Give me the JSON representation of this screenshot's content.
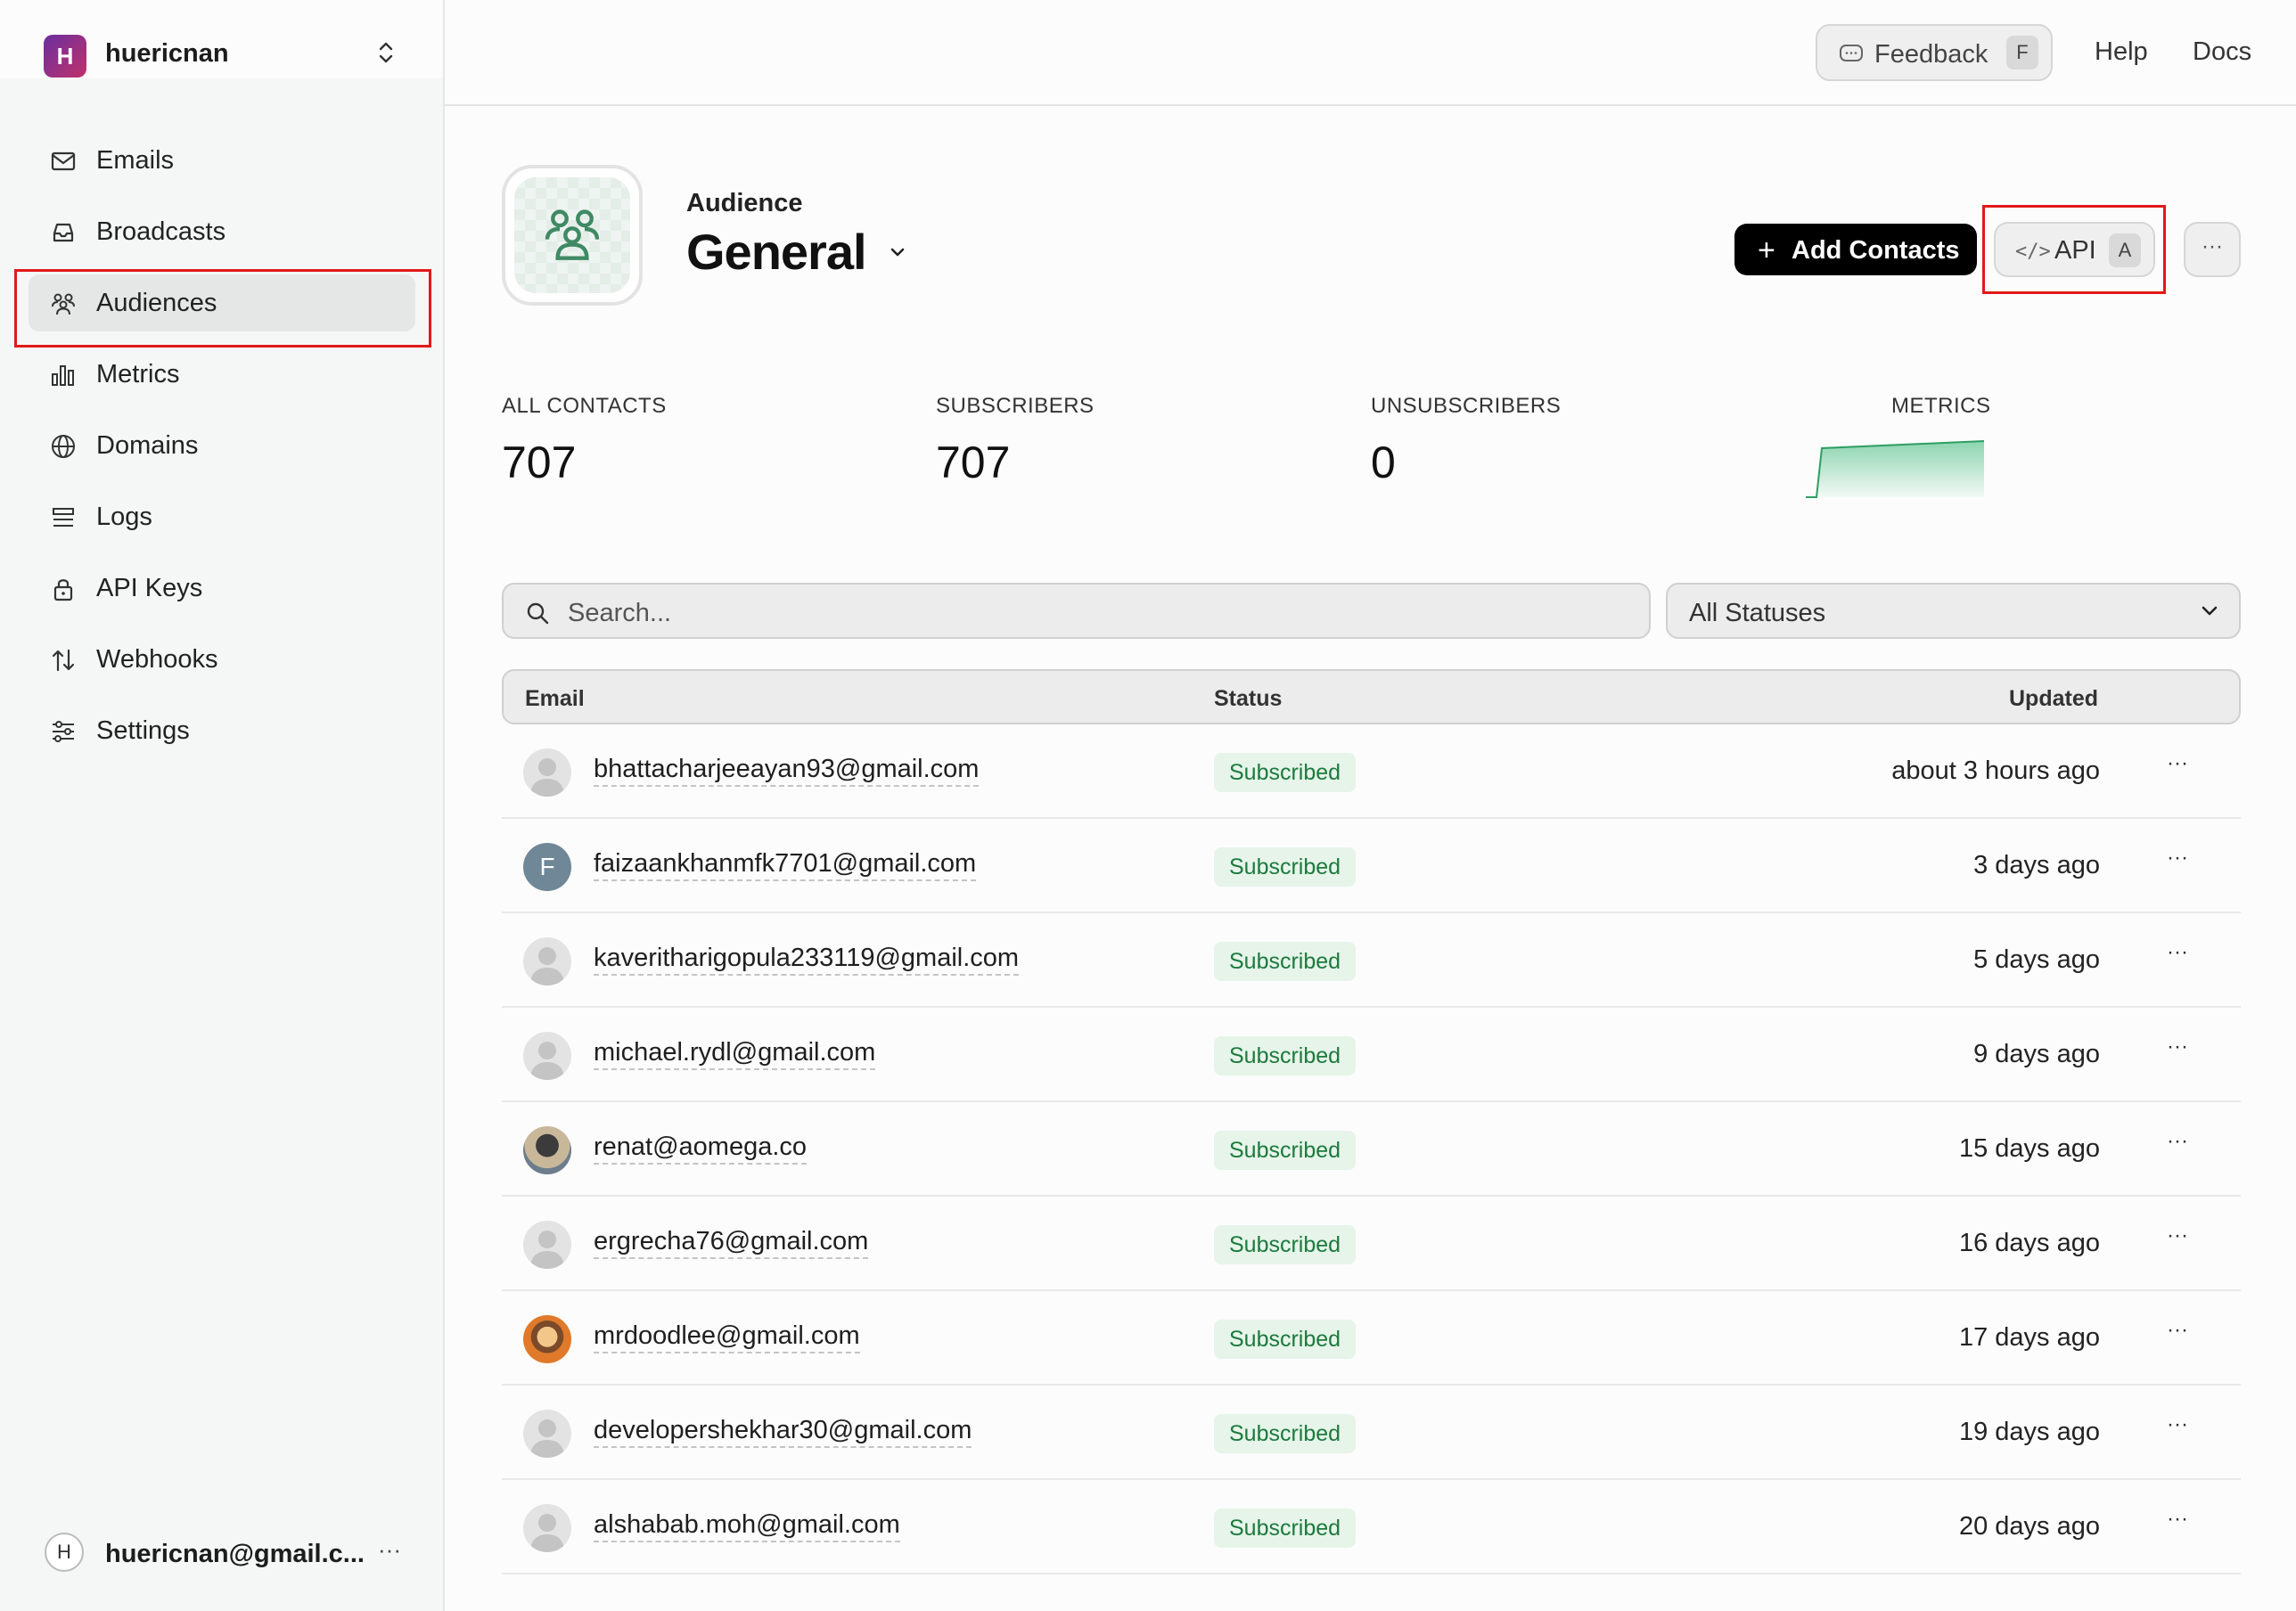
{
  "sidebar": {
    "team": {
      "initial": "H",
      "name": "huericnan"
    },
    "items": [
      {
        "label": "Emails",
        "icon": "mail-icon"
      },
      {
        "label": "Broadcasts",
        "icon": "inbox-icon"
      },
      {
        "label": "Audiences",
        "icon": "users-icon",
        "active": true
      },
      {
        "label": "Metrics",
        "icon": "bar-chart-icon"
      },
      {
        "label": "Domains",
        "icon": "globe-icon"
      },
      {
        "label": "Logs",
        "icon": "list-icon"
      },
      {
        "label": "API Keys",
        "icon": "lock-icon"
      },
      {
        "label": "Webhooks",
        "icon": "arrows-icon"
      },
      {
        "label": "Settings",
        "icon": "sliders-icon"
      }
    ],
    "user": {
      "initial": "H",
      "email": "huericnan@gmail.c...",
      "more": "···"
    }
  },
  "topbar": {
    "feedback_label": "Feedback",
    "feedback_shortcut": "F",
    "help_label": "Help",
    "docs_label": "Docs"
  },
  "header": {
    "label": "Audience",
    "name": "General",
    "add_contacts_label": "Add Contacts",
    "api_label": "API",
    "api_shortcut": "A",
    "more_label": "···"
  },
  "stats": [
    {
      "label": "ALL CONTACTS",
      "value": "707"
    },
    {
      "label": "SUBSCRIBERS",
      "value": "707"
    },
    {
      "label": "UNSUBSCRIBERS",
      "value": "0"
    },
    {
      "label": "METRICS"
    }
  ],
  "filters": {
    "search_placeholder": "Search...",
    "status_value": "All Statuses"
  },
  "table": {
    "columns": {
      "email": "Email",
      "status": "Status",
      "updated": "Updated"
    },
    "rows": [
      {
        "email": "bhattacharjeeayan93@gmail.com",
        "status": "Subscribed",
        "updated": "about 3 hours ago",
        "avatar": "default"
      },
      {
        "email": "faizaankhanmfk7701@gmail.com",
        "status": "Subscribed",
        "updated": "3 days ago",
        "avatar": "letter",
        "initial": "F"
      },
      {
        "email": "kaveritharigopula233119@gmail.com",
        "status": "Subscribed",
        "updated": "5 days ago",
        "avatar": "default"
      },
      {
        "email": "michael.rydl@gmail.com",
        "status": "Subscribed",
        "updated": "9 days ago",
        "avatar": "default"
      },
      {
        "email": "renat@aomega.co",
        "status": "Subscribed",
        "updated": "15 days ago",
        "avatar": "photo1"
      },
      {
        "email": "ergrecha76@gmail.com",
        "status": "Subscribed",
        "updated": "16 days ago",
        "avatar": "default"
      },
      {
        "email": "mrdoodlee@gmail.com",
        "status": "Subscribed",
        "updated": "17 days ago",
        "avatar": "photo2"
      },
      {
        "email": "developershekhar30@gmail.com",
        "status": "Subscribed",
        "updated": "19 days ago",
        "avatar": "default"
      },
      {
        "email": "alshabab.moh@gmail.com",
        "status": "Subscribed",
        "updated": "20 days ago",
        "avatar": "default"
      }
    ],
    "row_more": "···"
  },
  "colors": {
    "accent_black": "#000000",
    "status_green": "#1c7a3c",
    "status_bg": "#e6f4ea",
    "highlight_red": "#e11919"
  }
}
